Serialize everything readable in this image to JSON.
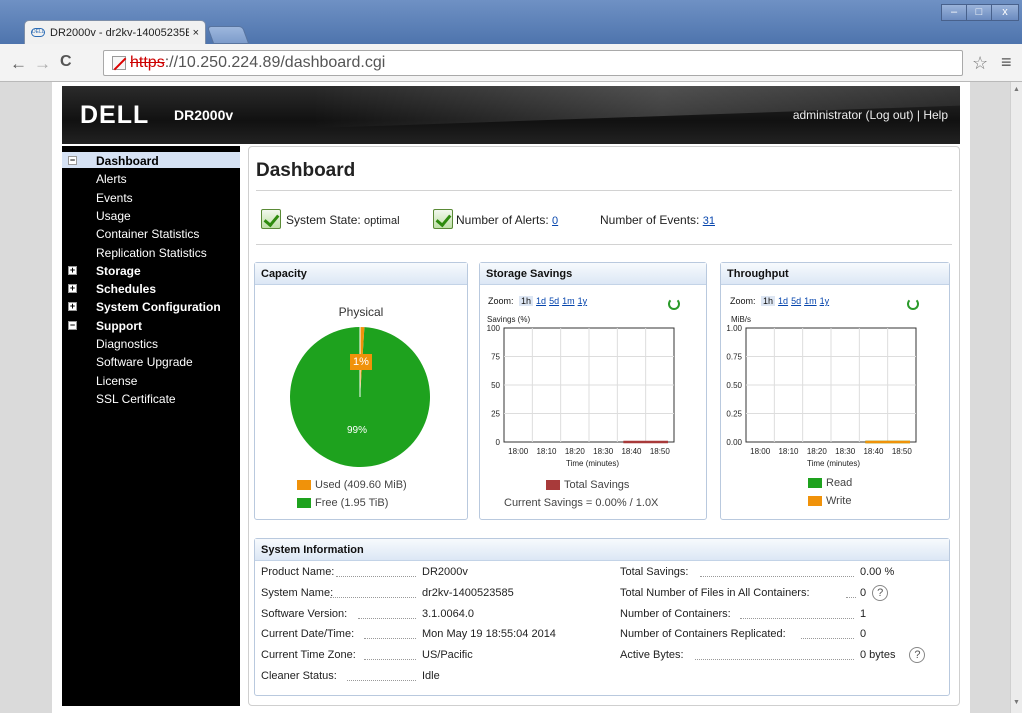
{
  "browser": {
    "tab_title": "DR2000v - dr2kv-14005235E",
    "favicon": "DELL",
    "tab_close": "×",
    "url_scheme": "https",
    "url_rest": "://10.250.224.89/dashboard.cgi",
    "back": "←",
    "forward": "→",
    "reload": "C",
    "star": "☆",
    "menu": "≡",
    "win_min": "–",
    "win_max": "□",
    "win_close": "x"
  },
  "banner": {
    "logo": "DELL",
    "product": "DR2000v",
    "user_links": "administrator (Log out)  |  Help"
  },
  "sidebar": {
    "items": [
      {
        "label": "Dashboard",
        "type": "group",
        "toggle": "−"
      },
      {
        "label": "Alerts",
        "type": "child"
      },
      {
        "label": "Events",
        "type": "child"
      },
      {
        "label": "Usage",
        "type": "child"
      },
      {
        "label": "Container Statistics",
        "type": "child"
      },
      {
        "label": "Replication Statistics",
        "type": "child"
      },
      {
        "label": "Storage",
        "type": "group",
        "toggle": "+"
      },
      {
        "label": "Schedules",
        "type": "group",
        "toggle": "+"
      },
      {
        "label": "System Configuration",
        "type": "group",
        "toggle": "+"
      },
      {
        "label": "Support",
        "type": "group",
        "toggle": "−"
      },
      {
        "label": "Diagnostics",
        "type": "child"
      },
      {
        "label": "Software Upgrade",
        "type": "child"
      },
      {
        "label": "License",
        "type": "child"
      },
      {
        "label": "SSL Certificate",
        "type": "child"
      }
    ]
  },
  "main": {
    "title": "Dashboard",
    "system_state_label": "System State:",
    "system_state_value": "optimal",
    "alerts_label": "Number of Alerts:",
    "alerts_value": "0",
    "events_label": "Number of Events:",
    "events_value": "31"
  },
  "capacity": {
    "title": "Capacity",
    "subtitle": "Physical",
    "used_pct_label": "1%",
    "free_pct_label": "99%",
    "used_legend": "Used (409.60 MiB)",
    "free_legend": "Free (1.95 TiB)",
    "used_color": "#f0920a",
    "free_color": "#1ea21e"
  },
  "zoom": {
    "label": "Zoom:",
    "options": [
      "1h",
      "1d",
      "5d",
      "1m",
      "1y"
    ],
    "selected": "1h"
  },
  "savings": {
    "title": "Storage Savings",
    "ylabel": "Savings (%)",
    "xlabel": "Time (minutes)",
    "legend": "Total Savings",
    "legend_color": "#a83a3a",
    "current": "Current Savings = 0.00% / 1.0X"
  },
  "throughput": {
    "title": "Throughput",
    "ylabel": "MiB/s",
    "xlabel": "Time (minutes)",
    "legend_read": "Read",
    "legend_write": "Write",
    "read_color": "#1ea21e",
    "write_color": "#f0920a"
  },
  "chart_data": [
    {
      "type": "pie",
      "title": "Physical",
      "categories": [
        "Used (409.60 MiB)",
        "Free (1.95 TiB)"
      ],
      "values": [
        1,
        99
      ],
      "colors": [
        "#f0920a",
        "#1ea21e"
      ]
    },
    {
      "type": "line",
      "title": "Storage Savings",
      "xlabel": "Time (minutes)",
      "ylabel": "Savings (%)",
      "x": [
        "18:00",
        "18:10",
        "18:20",
        "18:30",
        "18:40",
        "18:50"
      ],
      "xticks": [
        "18:00",
        "18:10",
        "18:20",
        "18:30",
        "18:40",
        "18:50"
      ],
      "yticks": [
        "0",
        "25",
        "50",
        "75",
        "100"
      ],
      "ylim": [
        0,
        100
      ],
      "series": [
        {
          "name": "Total Savings",
          "x": [
            "18:40",
            "18:50"
          ],
          "values": [
            0,
            0
          ],
          "color": "#a83a3a"
        }
      ],
      "grid": true
    },
    {
      "type": "line",
      "title": "Throughput",
      "xlabel": "Time (minutes)",
      "ylabel": "MiB/s",
      "xticks": [
        "18:00",
        "18:10",
        "18:20",
        "18:30",
        "18:40",
        "18:50"
      ],
      "yticks": [
        "0.00",
        "0.25",
        "0.50",
        "0.75",
        "1.00"
      ],
      "ylim": [
        0,
        1
      ],
      "series": [
        {
          "name": "Read",
          "x": [
            "18:40",
            "18:50"
          ],
          "values": [
            0,
            0
          ],
          "color": "#1ea21e"
        },
        {
          "name": "Write",
          "x": [
            "18:40",
            "18:50"
          ],
          "values": [
            0,
            0
          ],
          "color": "#f0920a"
        }
      ],
      "grid": true
    }
  ],
  "sysinfo": {
    "title": "System Information",
    "left": [
      {
        "label": "Product Name:",
        "value": "DR2000v"
      },
      {
        "label": "System Name:",
        "value": "dr2kv-1400523585"
      },
      {
        "label": "Software Version:",
        "value": "3.1.0064.0"
      },
      {
        "label": "Current Date/Time:",
        "value": "Mon May 19 18:55:04 2014"
      },
      {
        "label": "Current Time Zone:",
        "value": "US/Pacific"
      },
      {
        "label": "Cleaner Status:",
        "value": "Idle"
      }
    ],
    "right": [
      {
        "label": "Total Savings:",
        "value": "0.00 %"
      },
      {
        "label": "Total Number of Files in All Containers:",
        "value": "0",
        "help": true
      },
      {
        "label": "Number of Containers:",
        "value": "1"
      },
      {
        "label": "Number of Containers Replicated:",
        "value": "0"
      },
      {
        "label": "Active Bytes:",
        "value": "0 bytes",
        "help": true
      }
    ],
    "help_glyph": "?"
  }
}
